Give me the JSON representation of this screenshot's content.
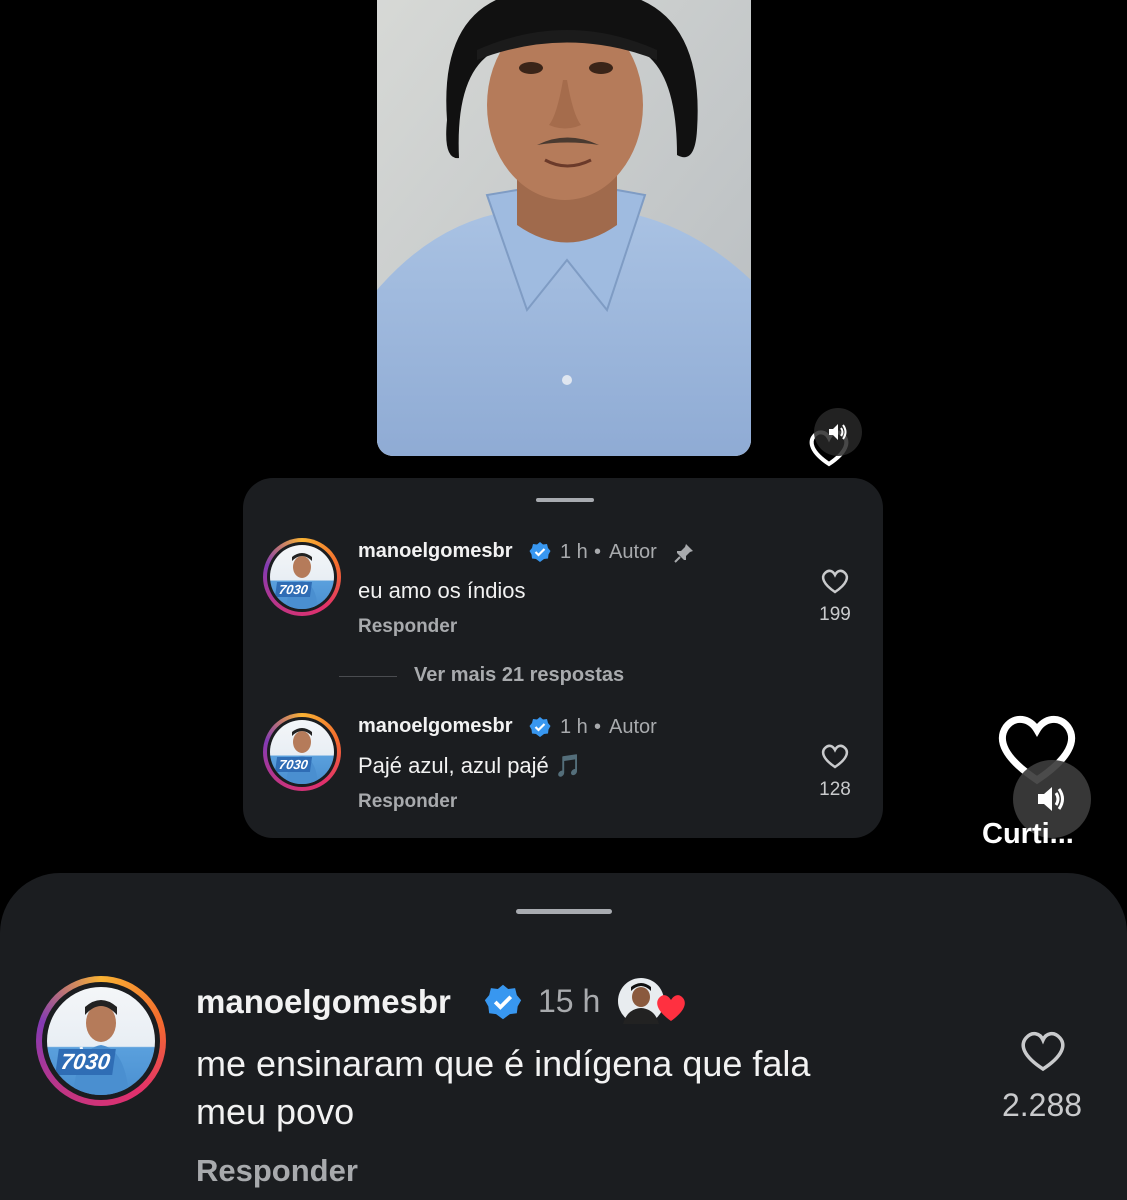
{
  "video": {
    "mute_icon": "volume-icon",
    "heart_icon": "heart-outline-icon"
  },
  "inner_comments": {
    "comments": [
      {
        "avatar_badge": "7030",
        "username": "manoelgomesbr",
        "time": "1 h",
        "separator": "•",
        "author_label": "Autor",
        "pinned_icon": "pin-icon",
        "text": "eu amo os índios",
        "reply_label": "Responder",
        "likes": "199"
      },
      {
        "avatar_badge": "7030",
        "username": "manoelgomesbr",
        "time": "1 h",
        "separator": "•",
        "author_label": "Autor",
        "text": "Pajé azul, azul pajé 🎵",
        "reply_label": "Responder",
        "likes": "128"
      }
    ],
    "more_replies": "Ver mais 21 respostas"
  },
  "side_actions": {
    "like_label": "Curti..."
  },
  "main_comment": {
    "avatar_badge": "7030",
    "username": "manoelgomesbr",
    "time": "15 h",
    "text_line1": "me ensinaram que é indígena que fala",
    "text_line2": "meu povo",
    "reply_label": "Responder",
    "likes": "2.288"
  },
  "colors": {
    "background": "#000000",
    "sheet": "#1b1d20",
    "verified": "#3897f0",
    "liked_heart": "#ff3040"
  }
}
